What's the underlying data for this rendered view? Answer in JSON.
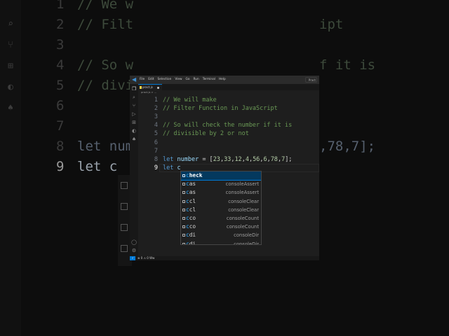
{
  "background": {
    "lines": [
      {
        "num": "1",
        "text": "// We w"
      },
      {
        "num": "2",
        "text": "// Filt",
        "tail": "ipt"
      },
      {
        "num": "3",
        "text": ""
      },
      {
        "num": "4",
        "text": "// So w",
        "tail": "f it is"
      },
      {
        "num": "5",
        "text": "// divi"
      },
      {
        "num": "6",
        "text": ""
      },
      {
        "num": "7",
        "text": ""
      },
      {
        "num": "8",
        "text": "let num",
        "tail": ",78,7];"
      },
      {
        "num": "9",
        "text": "let c"
      }
    ]
  },
  "window": {
    "menu": [
      "File",
      "Edit",
      "Selection",
      "View",
      "Go",
      "Run",
      "Terminal",
      "Help"
    ],
    "search_label": "Pract",
    "tab": {
      "name": "pract.js"
    },
    "breadcrumb": "pract.js > ...",
    "editor": {
      "lines": [
        {
          "num": "1",
          "text": "// We will make"
        },
        {
          "num": "2",
          "text": "// Filter Function in JavaScript"
        },
        {
          "num": "3",
          "text": ""
        },
        {
          "num": "4",
          "text": "// So will check the number if it is"
        },
        {
          "num": "5",
          "text": "// divisible by 2 or not"
        },
        {
          "num": "6",
          "text": ""
        },
        {
          "num": "7",
          "text": ""
        },
        {
          "num": "8",
          "kw": "let",
          "var": "number",
          "rest": " = [23,33,12,4,56,6,78,7];"
        },
        {
          "num": "9",
          "kw": "let",
          "var": "c",
          "rest": ""
        }
      ]
    },
    "suggestions": [
      {
        "prefix": "c",
        "rest": "heck",
        "detail": ""
      },
      {
        "prefix": "c",
        "rest": "as",
        "detail": "consoleAssert"
      },
      {
        "prefix": "c",
        "rest": "as",
        "detail": "consoleAssert"
      },
      {
        "prefix": "c",
        "rest": "cl",
        "detail": "consoleClear"
      },
      {
        "prefix": "c",
        "rest": "cl",
        "detail": "consoleClear"
      },
      {
        "prefix": "c",
        "rest": "co",
        "detail": "consoleCount"
      },
      {
        "prefix": "c",
        "rest": "co",
        "detail": "consoleCount"
      },
      {
        "prefix": "c",
        "rest": "di",
        "detail": "consoleDir"
      },
      {
        "prefix": "c",
        "rest": "di",
        "detail": "consoleDir"
      }
    ],
    "status": {
      "remote": "⚡",
      "text": "⊗ 0 ⚠ 0  Ww"
    },
    "colors": {
      "accent": "#0078d4",
      "comment": "#6a9955",
      "keyword": "#569cd6",
      "variable": "#9cdcfe",
      "number": "#b5cea8"
    }
  }
}
